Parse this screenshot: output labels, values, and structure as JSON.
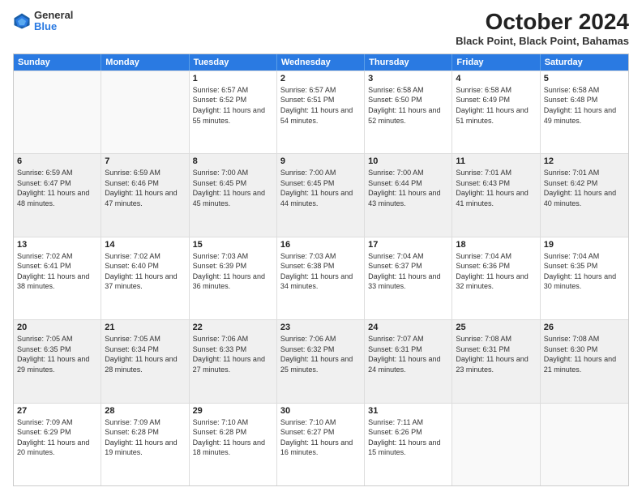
{
  "logo": {
    "general": "General",
    "blue": "Blue"
  },
  "title": "October 2024",
  "location": "Black Point, Black Point, Bahamas",
  "days": [
    "Sunday",
    "Monday",
    "Tuesday",
    "Wednesday",
    "Thursday",
    "Friday",
    "Saturday"
  ],
  "rows": [
    [
      {
        "day": "",
        "info": "",
        "empty": true
      },
      {
        "day": "",
        "info": "",
        "empty": true
      },
      {
        "day": "1",
        "info": "Sunrise: 6:57 AM\nSunset: 6:52 PM\nDaylight: 11 hours and 55 minutes."
      },
      {
        "day": "2",
        "info": "Sunrise: 6:57 AM\nSunset: 6:51 PM\nDaylight: 11 hours and 54 minutes."
      },
      {
        "day": "3",
        "info": "Sunrise: 6:58 AM\nSunset: 6:50 PM\nDaylight: 11 hours and 52 minutes."
      },
      {
        "day": "4",
        "info": "Sunrise: 6:58 AM\nSunset: 6:49 PM\nDaylight: 11 hours and 51 minutes."
      },
      {
        "day": "5",
        "info": "Sunrise: 6:58 AM\nSunset: 6:48 PM\nDaylight: 11 hours and 49 minutes."
      }
    ],
    [
      {
        "day": "6",
        "info": "Sunrise: 6:59 AM\nSunset: 6:47 PM\nDaylight: 11 hours and 48 minutes."
      },
      {
        "day": "7",
        "info": "Sunrise: 6:59 AM\nSunset: 6:46 PM\nDaylight: 11 hours and 47 minutes."
      },
      {
        "day": "8",
        "info": "Sunrise: 7:00 AM\nSunset: 6:45 PM\nDaylight: 11 hours and 45 minutes."
      },
      {
        "day": "9",
        "info": "Sunrise: 7:00 AM\nSunset: 6:45 PM\nDaylight: 11 hours and 44 minutes."
      },
      {
        "day": "10",
        "info": "Sunrise: 7:00 AM\nSunset: 6:44 PM\nDaylight: 11 hours and 43 minutes."
      },
      {
        "day": "11",
        "info": "Sunrise: 7:01 AM\nSunset: 6:43 PM\nDaylight: 11 hours and 41 minutes."
      },
      {
        "day": "12",
        "info": "Sunrise: 7:01 AM\nSunset: 6:42 PM\nDaylight: 11 hours and 40 minutes."
      }
    ],
    [
      {
        "day": "13",
        "info": "Sunrise: 7:02 AM\nSunset: 6:41 PM\nDaylight: 11 hours and 38 minutes."
      },
      {
        "day": "14",
        "info": "Sunrise: 7:02 AM\nSunset: 6:40 PM\nDaylight: 11 hours and 37 minutes."
      },
      {
        "day": "15",
        "info": "Sunrise: 7:03 AM\nSunset: 6:39 PM\nDaylight: 11 hours and 36 minutes."
      },
      {
        "day": "16",
        "info": "Sunrise: 7:03 AM\nSunset: 6:38 PM\nDaylight: 11 hours and 34 minutes."
      },
      {
        "day": "17",
        "info": "Sunrise: 7:04 AM\nSunset: 6:37 PM\nDaylight: 11 hours and 33 minutes."
      },
      {
        "day": "18",
        "info": "Sunrise: 7:04 AM\nSunset: 6:36 PM\nDaylight: 11 hours and 32 minutes."
      },
      {
        "day": "19",
        "info": "Sunrise: 7:04 AM\nSunset: 6:35 PM\nDaylight: 11 hours and 30 minutes."
      }
    ],
    [
      {
        "day": "20",
        "info": "Sunrise: 7:05 AM\nSunset: 6:35 PM\nDaylight: 11 hours and 29 minutes."
      },
      {
        "day": "21",
        "info": "Sunrise: 7:05 AM\nSunset: 6:34 PM\nDaylight: 11 hours and 28 minutes."
      },
      {
        "day": "22",
        "info": "Sunrise: 7:06 AM\nSunset: 6:33 PM\nDaylight: 11 hours and 27 minutes."
      },
      {
        "day": "23",
        "info": "Sunrise: 7:06 AM\nSunset: 6:32 PM\nDaylight: 11 hours and 25 minutes."
      },
      {
        "day": "24",
        "info": "Sunrise: 7:07 AM\nSunset: 6:31 PM\nDaylight: 11 hours and 24 minutes."
      },
      {
        "day": "25",
        "info": "Sunrise: 7:08 AM\nSunset: 6:31 PM\nDaylight: 11 hours and 23 minutes."
      },
      {
        "day": "26",
        "info": "Sunrise: 7:08 AM\nSunset: 6:30 PM\nDaylight: 11 hours and 21 minutes."
      }
    ],
    [
      {
        "day": "27",
        "info": "Sunrise: 7:09 AM\nSunset: 6:29 PM\nDaylight: 11 hours and 20 minutes."
      },
      {
        "day": "28",
        "info": "Sunrise: 7:09 AM\nSunset: 6:28 PM\nDaylight: 11 hours and 19 minutes."
      },
      {
        "day": "29",
        "info": "Sunrise: 7:10 AM\nSunset: 6:28 PM\nDaylight: 11 hours and 18 minutes."
      },
      {
        "day": "30",
        "info": "Sunrise: 7:10 AM\nSunset: 6:27 PM\nDaylight: 11 hours and 16 minutes."
      },
      {
        "day": "31",
        "info": "Sunrise: 7:11 AM\nSunset: 6:26 PM\nDaylight: 11 hours and 15 minutes."
      },
      {
        "day": "",
        "info": "",
        "empty": true
      },
      {
        "day": "",
        "info": "",
        "empty": true
      }
    ]
  ]
}
